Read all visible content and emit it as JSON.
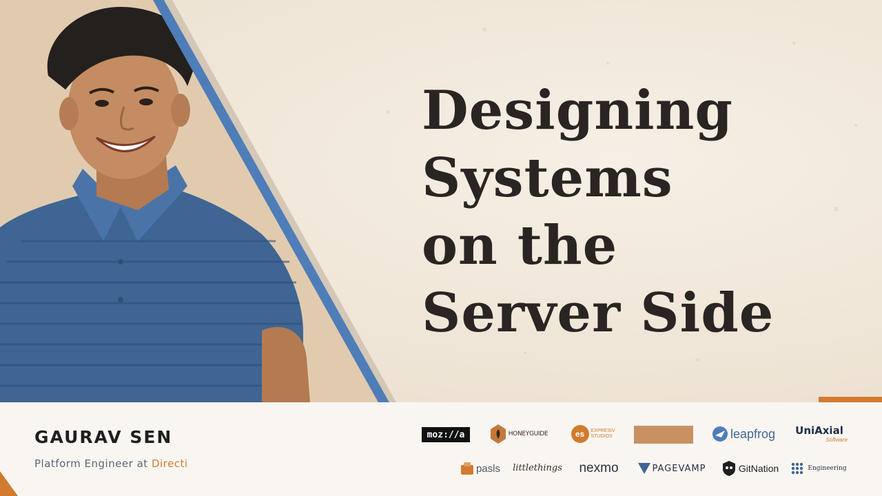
{
  "talk": {
    "title_lines": [
      "Designing",
      "Systems",
      "on the",
      "Server Side"
    ]
  },
  "speaker": {
    "name": "GAURAV SEN",
    "role_prefix": "Platform Engineer at",
    "company": "Directi"
  },
  "sponsors": {
    "row1": [
      "moz://a",
      "HONEYGUIDE",
      "EXPRESIV STUDIOS",
      "leapfrog",
      "UniAxial",
      "Software"
    ],
    "row2": [
      "pasls",
      "littlethings",
      "nexmo",
      "PAGEVAMP",
      "GitNation",
      "Engineering"
    ]
  },
  "colors": {
    "accent_orange": "#d27a2e",
    "stripe_blue": "#4f7db8",
    "title_text": "#2a2523"
  }
}
